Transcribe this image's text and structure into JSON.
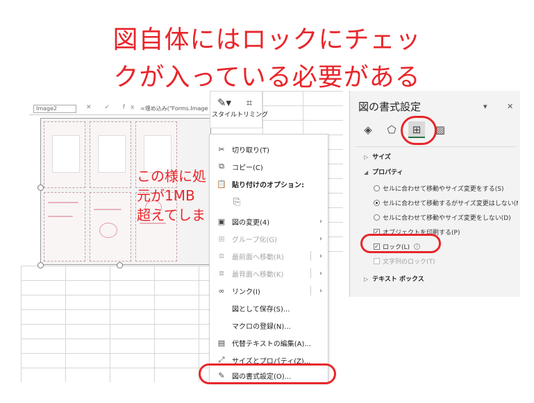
{
  "title": {
    "line1": "図自体にはロックにチェッ",
    "line2": "クが入っている必要がある"
  },
  "excel": {
    "name_box": "Image2",
    "formula_icons": "✕ ✓ fx",
    "formula": "=埋め込み(\"Forms.Image",
    "overlay_text": {
      "line1": "この様に処",
      "line2": "元が1MB",
      "line3": "超えてしま"
    }
  },
  "mini_toolbar": {
    "style_label": "スタイル",
    "crop_label": "トリミング"
  },
  "context_menu": {
    "items": [
      {
        "label": "切り取り(T)",
        "icon": "scissors-icon"
      },
      {
        "label": "コピー(C)",
        "icon": "copy-icon"
      },
      {
        "label": "貼り付けのオプション:",
        "icon": "paste-icon"
      },
      {
        "label": "図の変更(4)",
        "icon": "change-picture-icon"
      },
      {
        "label": "グループ化(G)",
        "icon": "group-icon"
      },
      {
        "label": "最前面へ移動(R)",
        "icon": "bring-front-icon"
      },
      {
        "label": "最背面へ移動(K)",
        "icon": "send-back-icon"
      },
      {
        "label": "リンク(I)",
        "icon": "link-icon"
      },
      {
        "label": "図として保存(S)..."
      },
      {
        "label": "マクロの登録(N)..."
      },
      {
        "label": "代替テキストの編集(A)...",
        "icon": "alt-text-icon"
      },
      {
        "label": "サイズとプロパティ(Z)...",
        "icon": "size-icon"
      },
      {
        "label": "図の書式設定(O)...",
        "icon": "format-picture-icon"
      }
    ]
  },
  "format_pane": {
    "title": "図の書式設定",
    "sections": {
      "size": "サイズ",
      "properties": "プロパティ",
      "textbox": "テキスト ボックス"
    },
    "options": {
      "move_and_size": "セルに合わせて移動やサイズ変更をする(S)",
      "move_no_size": "セルに合わせて移動するがサイズ変更はしない(M)",
      "no_move_no_size": "セルに合わせて移動やサイズ変更をしない(D)",
      "print_object": "オブジェクトを印刷する(P)",
      "lock": "ロック(L)",
      "lock_text": "文字列のロック(T)"
    }
  },
  "colors": {
    "annotation_red": "#e8262b",
    "excel_green": "#217346"
  }
}
